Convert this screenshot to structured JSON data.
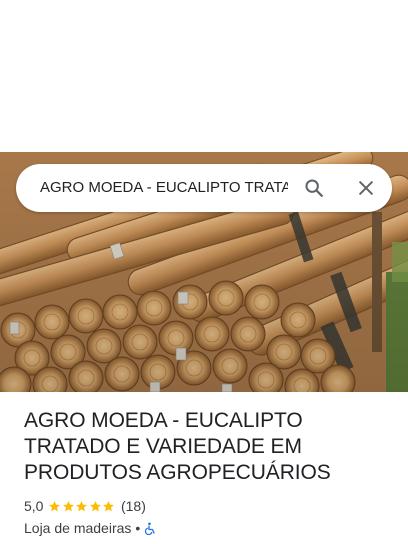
{
  "search": {
    "query": "AGRO MOEDA - EUCALIPTO TRATADO"
  },
  "place": {
    "name": "AGRO MOEDA - EUCALIPTO TRATADO E VARIEDADE EM PRODUTOS AGROPECUÁRIOS",
    "rating": "5,0",
    "rating_stars": 5,
    "reviews": "(18)",
    "category": "Loja de madeiras",
    "separator": "•"
  },
  "icons": {
    "search": "search-icon",
    "close": "close-icon",
    "star": "star-icon",
    "accessibility": "wheelchair-accessible-icon"
  },
  "colors": {
    "star": "#fbbc04",
    "accessibility": "#1a73e8",
    "text": "#202124",
    "secondary_text": "#3c4043"
  }
}
